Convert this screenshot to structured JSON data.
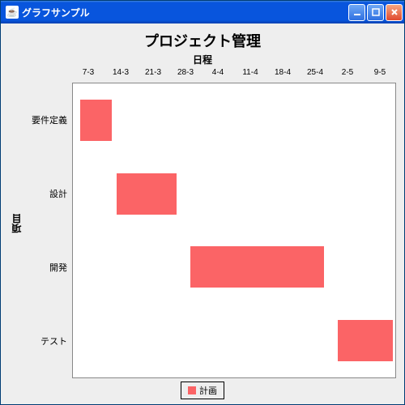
{
  "window": {
    "title": "グラフサンプル"
  },
  "chart_data": {
    "type": "bar",
    "orientation": "horizontal-range",
    "title": "プロジェクト管理",
    "xlabel": "日程",
    "ylabel": "項目",
    "x_ticks": [
      "7-3",
      "14-3",
      "21-3",
      "28-3",
      "4-4",
      "11-4",
      "18-4",
      "25-4",
      "2-5",
      "9-5"
    ],
    "categories": [
      "要件定義",
      "設計",
      "開発",
      "テスト"
    ],
    "series": [
      {
        "name": "計画",
        "color": "#fb6466",
        "ranges": [
          {
            "category": "要件定義",
            "start": "5-3",
            "end": "12-3"
          },
          {
            "category": "設計",
            "start": "13-3",
            "end": "26-3"
          },
          {
            "category": "開発",
            "start": "29-3",
            "end": "27-4"
          },
          {
            "category": "テスト",
            "start": "30-4",
            "end": "12-5"
          }
        ]
      }
    ],
    "legend": {
      "position": "bottom"
    },
    "grid": false
  }
}
